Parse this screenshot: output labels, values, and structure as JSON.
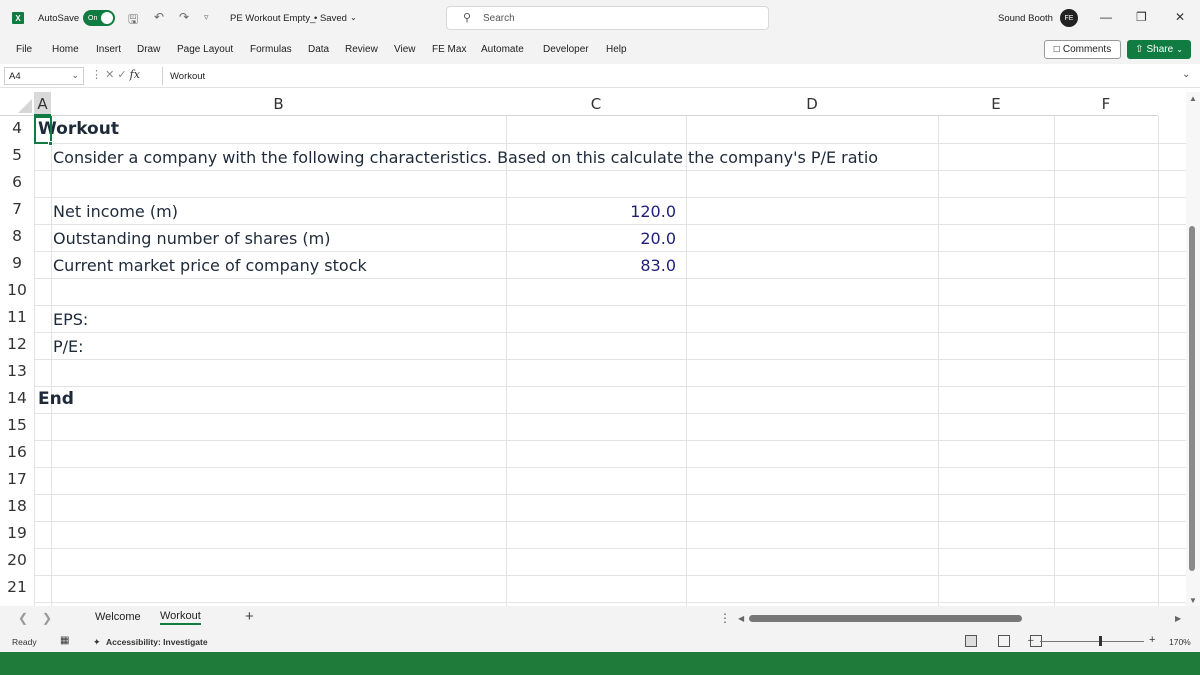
{
  "titlebar": {
    "autosave_label": "AutoSave",
    "autosave_state": "On",
    "doc_title": "PE Workout Empty_",
    "save_status": "• Saved",
    "search_placeholder": "Search",
    "user_name": "Sound Booth",
    "avatar_initials": "FE"
  },
  "ribbon": {
    "tabs": [
      "File",
      "Home",
      "Insert",
      "Draw",
      "Page Layout",
      "Formulas",
      "Data",
      "Review",
      "View",
      "FE Max",
      "Automate",
      "Developer",
      "Help"
    ],
    "comments_label": "Comments",
    "share_label": "Share"
  },
  "formula_bar": {
    "name_box": "A4",
    "fx_label": "fx",
    "value": "Workout"
  },
  "grid": {
    "columns": [
      "A",
      "B",
      "C",
      "D",
      "E",
      "F"
    ],
    "rows": [
      "4",
      "5",
      "6",
      "7",
      "8",
      "9",
      "10",
      "11",
      "12",
      "13",
      "14",
      "15",
      "16",
      "17",
      "18",
      "19",
      "20",
      "21"
    ],
    "cells": {
      "a4": "Workout",
      "b5": "Consider a company with the following characteristics. Based on this calculate the company's P/E ratio",
      "b7": "Net income (m)",
      "c7": "120.0",
      "b8": "Outstanding number of shares  (m)",
      "c8": "20.0",
      "b9": "Current market price of company stock",
      "c9": "83.0",
      "b11": "EPS:",
      "b12": "P/E:",
      "a14": "End"
    },
    "selected_cell": "A4"
  },
  "sheets": {
    "tabs": [
      "Welcome",
      "Workout"
    ],
    "active": "Workout",
    "add_label": "+"
  },
  "status": {
    "ready": "Ready",
    "accessibility": "Accessibility: Investigate",
    "zoom": "170%"
  },
  "colors": {
    "excel_green": "#107c41",
    "number_text": "#1f1f7a"
  }
}
